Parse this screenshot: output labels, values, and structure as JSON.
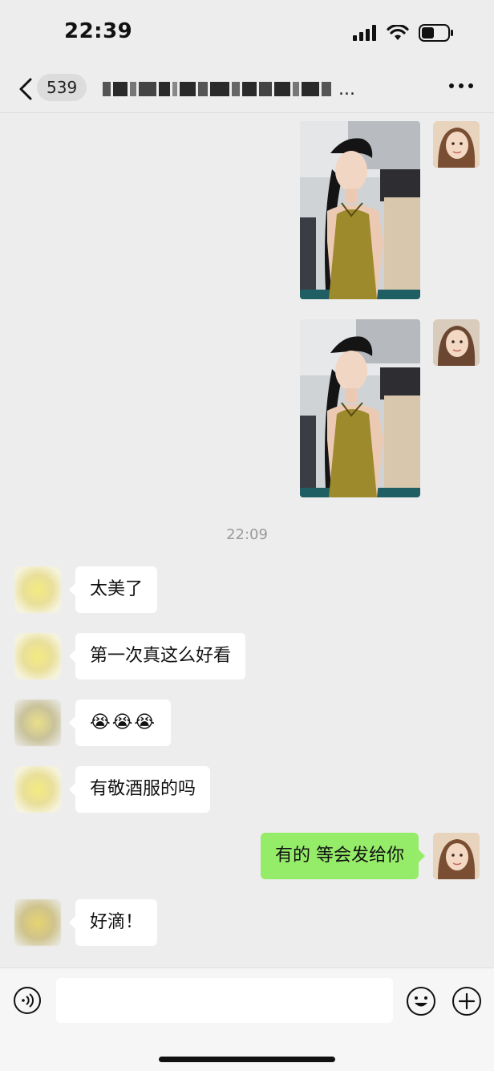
{
  "status_bar": {
    "time": "22:39"
  },
  "header": {
    "unread_count": "539",
    "title_obscured": "▇▆▅▄ ▇▅ ▇▆▇ ▆▅▇▆..."
  },
  "chat": {
    "timestamp": "22:09",
    "messages_left": [
      {
        "text": "太美了"
      },
      {
        "text": "第一次真这么好看"
      },
      {
        "text": "😭😭😭"
      },
      {
        "text": "有敬酒服的吗"
      },
      {
        "text": "好滴！"
      }
    ],
    "message_right": {
      "text": "有的 等会发给你"
    }
  },
  "colors": {
    "background": "#ededed",
    "my_bubble": "#95ec69",
    "other_bubble": "#ffffff",
    "dress": "#9c8a2c"
  },
  "icons": [
    "back-icon",
    "signal-icon",
    "wifi-icon",
    "battery-icon",
    "more-icon",
    "voice-icon",
    "emoji-icon",
    "plus-icon"
  ]
}
